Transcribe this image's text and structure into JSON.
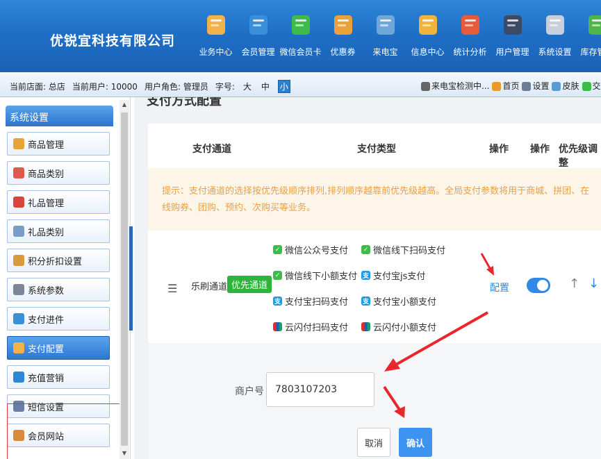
{
  "header": {
    "company": "优锐宜科技有限公司",
    "nav": [
      {
        "label": "业务中心",
        "icon": "business-icon",
        "color": "#f1b24a"
      },
      {
        "label": "会员管理",
        "icon": "member-icon",
        "color": "#3a8fd9"
      },
      {
        "label": "微信会员卡",
        "icon": "wechat-icon",
        "color": "#3ebb4a"
      },
      {
        "label": "优惠券",
        "icon": "coupon-icon",
        "color": "#e9a23b"
      },
      {
        "label": "来电宝",
        "icon": "phone-icon",
        "color": "#6fa7d8"
      },
      {
        "label": "信息中心",
        "icon": "mail-icon",
        "color": "#f0b43c"
      },
      {
        "label": "统计分析",
        "icon": "chart-icon",
        "color": "#e85b3a"
      },
      {
        "label": "用户管理",
        "icon": "user-icon",
        "color": "#3c4a63"
      },
      {
        "label": "系统设置",
        "icon": "tools-icon",
        "color": "#c8cfd8"
      },
      {
        "label": "库存管理",
        "icon": "stock-icon",
        "color": "#4fb54a"
      }
    ]
  },
  "infobar": {
    "store_label": "当前店面:",
    "store": "总店",
    "user_label": "当前用户:",
    "user": "10000",
    "role_label": "用户角色:",
    "role": "管理员",
    "font_label": "字号:",
    "font_large": "大",
    "font_medium": "中",
    "font_small": "小",
    "links": [
      "来电宝检测中...",
      "首页",
      "设置",
      "皮肤",
      "交班"
    ]
  },
  "sidebar": {
    "title": "系统设置",
    "items": [
      {
        "label": "商品管理",
        "color": "#e8a33a",
        "active": false
      },
      {
        "label": "商品类别",
        "color": "#e05a4a",
        "active": false
      },
      {
        "label": "礼品管理",
        "color": "#d8453a",
        "active": false
      },
      {
        "label": "礼品类别",
        "color": "#7a9cc8",
        "active": false
      },
      {
        "label": "积分折扣设置",
        "color": "#d89a3a",
        "active": false
      },
      {
        "label": "系统参数",
        "color": "#7b8796",
        "active": false
      },
      {
        "label": "支付进件",
        "color": "#3a8fd9",
        "active": false
      },
      {
        "label": "支付配置",
        "color": "#f1b24a",
        "active": true
      },
      {
        "label": "充值营销",
        "color": "#2c88d8",
        "active": false
      },
      {
        "label": "短信设置",
        "color": "#6a7fa8",
        "active": false
      },
      {
        "label": "会员网站",
        "color": "#d88a3a",
        "active": false
      }
    ]
  },
  "main": {
    "title": "支付方式配置",
    "table_headers": {
      "channel": "支付通道",
      "type": "支付类型",
      "op1": "操作",
      "op2": "操作",
      "priority": "优先级调整"
    },
    "notice": "提示：支付通道的选择按优先级顺序排列,排列顺序越靠前优先级越高。全局支付参数将用于商城、拼团、在线购券、团购、预约、次购买等业务。",
    "row": {
      "channel_name": "乐刷通道",
      "tag": "优先通道",
      "pay_types": [
        {
          "label": "微信公众号支付",
          "kind": "wx"
        },
        {
          "label": "微信线下扫码支付",
          "kind": "wx"
        },
        {
          "label": "微信线下小额支付",
          "kind": "wx"
        },
        {
          "label": "支付宝js支付",
          "kind": "ali"
        },
        {
          "label": "支付宝扫码支付",
          "kind": "ali"
        },
        {
          "label": "支付宝小额支付",
          "kind": "ali"
        },
        {
          "label": "云闪付扫码支付",
          "kind": "up"
        },
        {
          "label": "云闪付小额支付",
          "kind": "up"
        }
      ],
      "config_link": "配置",
      "enabled": true
    },
    "form": {
      "merchant_label": "商户号",
      "merchant_value": "7803107203",
      "cancel": "取消",
      "confirm": "确认"
    }
  }
}
